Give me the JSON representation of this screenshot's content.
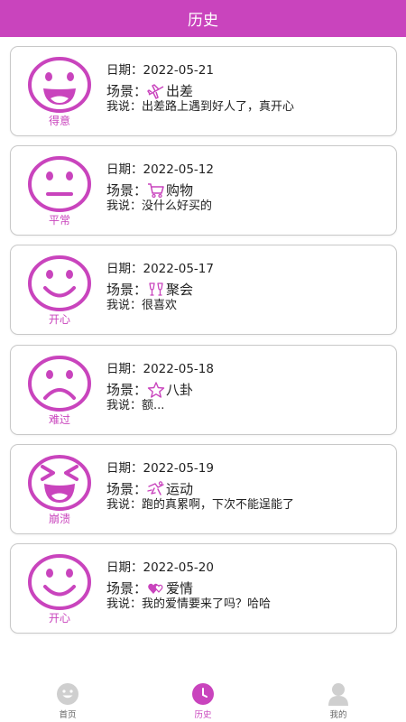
{
  "header": {
    "title": "历史"
  },
  "labels": {
    "date_prefix": "日期：",
    "scene_prefix": "场景：",
    "say_prefix": "我说："
  },
  "records": [
    {
      "date": "2022-05-21",
      "scene": "出差",
      "scene_icon": "airplane-icon",
      "say": "出差路上遇到好人了，真开心",
      "mood": "得意",
      "mood_icon": "grin-face-icon"
    },
    {
      "date": "2022-05-12",
      "scene": "购物",
      "scene_icon": "shopping-cart-icon",
      "say": "没什么好买的",
      "mood": "平常",
      "mood_icon": "neutral-face-icon"
    },
    {
      "date": "2022-05-17",
      "scene": "聚会",
      "scene_icon": "cheers-glasses-icon",
      "say": "很喜欢",
      "mood": "开心",
      "mood_icon": "smile-face-icon"
    },
    {
      "date": "2022-05-18",
      "scene": "八卦",
      "scene_icon": "star-icon",
      "say": "额...",
      "mood": "难过",
      "mood_icon": "sad-face-icon"
    },
    {
      "date": "2022-05-19",
      "scene": "运动",
      "scene_icon": "sport-icon",
      "say": "跑的真累啊，下次不能逞能了",
      "mood": "崩溃",
      "mood_icon": "squint-laugh-face-icon"
    },
    {
      "date": "2022-05-20",
      "scene": "爱情",
      "scene_icon": "hearts-icon",
      "say": "我的爱情要来了吗？哈哈",
      "mood": "开心",
      "mood_icon": "smile-face-icon"
    }
  ],
  "tabbar": {
    "items": [
      {
        "label": "首页",
        "icon": "home-face-icon",
        "active": false
      },
      {
        "label": "历史",
        "icon": "clock-icon",
        "active": true
      },
      {
        "label": "我的",
        "icon": "user-icon",
        "active": false
      }
    ]
  },
  "colors": {
    "accent": "#c944bd",
    "border": "#c8c8c8",
    "inactive_icon": "#cfcfcf"
  }
}
